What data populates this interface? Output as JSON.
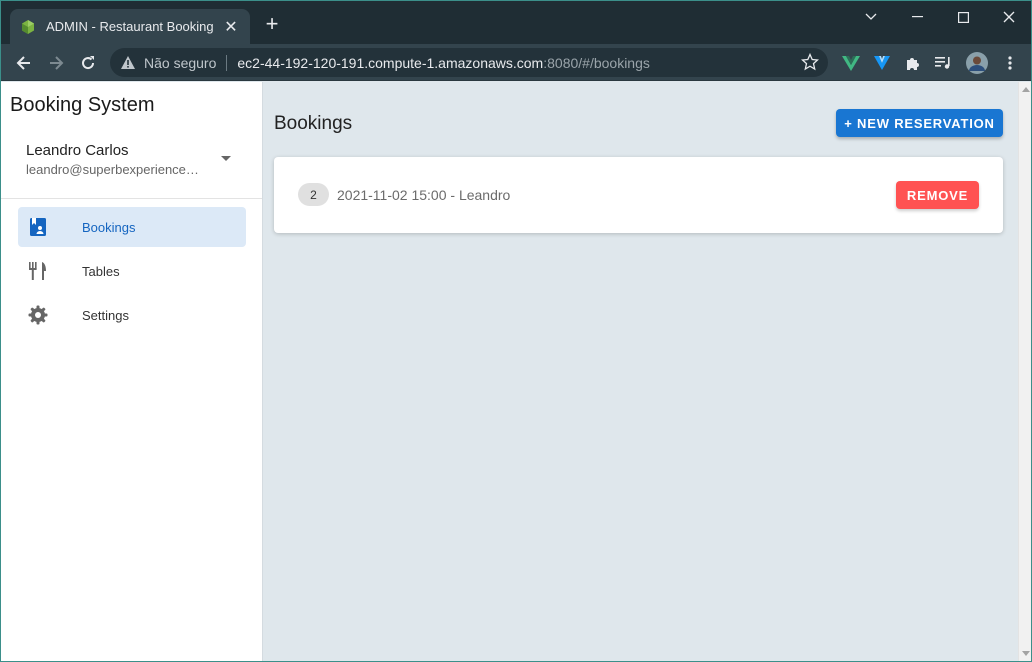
{
  "browser": {
    "tab_title": "ADMIN - Restaurant Booking",
    "secure_label": "Não seguro",
    "url_host": "ec2-44-192-120-191.compute-1.amazonaws.com",
    "url_rest": ":8080/#/bookings"
  },
  "sidebar": {
    "brand": "Booking System",
    "user_name": "Leandro Carlos",
    "user_email": "leandro@superbexperience.com",
    "items": [
      {
        "label": "Bookings",
        "icon": "bookings-icon",
        "active": true
      },
      {
        "label": "Tables",
        "icon": "utensils-icon",
        "active": false
      },
      {
        "label": "Settings",
        "icon": "gear-icon",
        "active": false
      }
    ]
  },
  "main": {
    "title": "Bookings",
    "new_button": "+ NEW RESERVATION",
    "bookings": [
      {
        "guests": "2",
        "text": "2021-11-02 15:00 - Leandro",
        "remove_label": "REMOVE"
      }
    ]
  },
  "colors": {
    "primary": "#1976d2",
    "danger": "#ff5252",
    "active_nav_bg": "#dce9f7"
  }
}
